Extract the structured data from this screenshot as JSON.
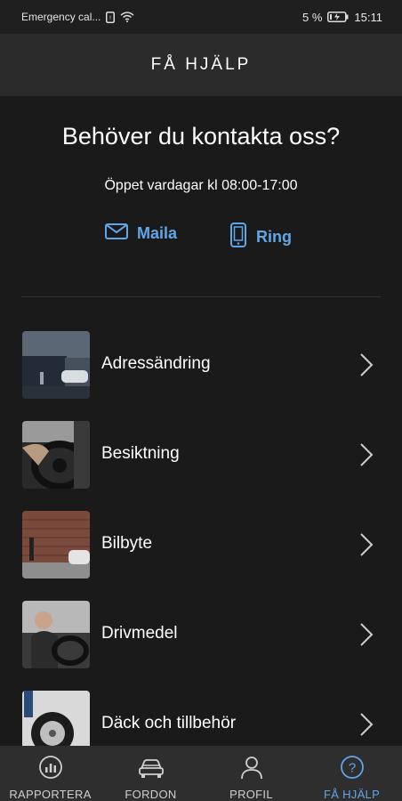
{
  "status_bar": {
    "left_text": "Emergency cal...",
    "battery": "5 %",
    "time": "15:11"
  },
  "header": {
    "title": "FÅ HJÄLP"
  },
  "contact": {
    "title": "Behöver du kontakta oss?",
    "hours": "Öppet vardagar kl 08:00-17:00",
    "mail_label": "Maila",
    "ring_label": "Ring"
  },
  "help_items": [
    {
      "label": "Adressändring"
    },
    {
      "label": "Besiktning"
    },
    {
      "label": "Bilbyte"
    },
    {
      "label": "Drivmedel"
    },
    {
      "label": "Däck och tillbehör"
    }
  ],
  "bottom_nav": [
    {
      "label": "RAPPORTERA",
      "icon": "report-icon"
    },
    {
      "label": "FORDON",
      "icon": "car-icon"
    },
    {
      "label": "PROFIL",
      "icon": "person-icon"
    },
    {
      "label": "FÅ HJÄLP",
      "icon": "help-icon",
      "active": true
    }
  ],
  "colors": {
    "accent": "#5fa7e8",
    "background": "#1a1a1a",
    "header": "#2b2b2b"
  }
}
